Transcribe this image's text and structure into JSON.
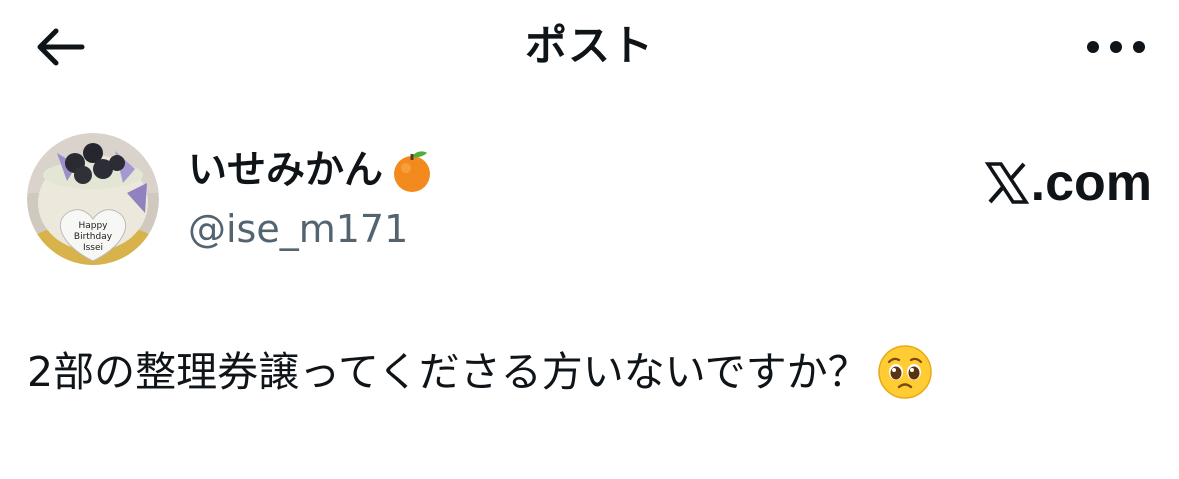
{
  "header": {
    "title": "ポスト",
    "back_icon": "arrow-left-icon",
    "more_icon": "more-horizontal-icon"
  },
  "author": {
    "display_name": "いせみかん",
    "name_emoji": "tangerine-icon",
    "handle": "@ise_m171",
    "avatar_text": [
      "Happy",
      "Birthday",
      "Issei"
    ]
  },
  "brand": {
    "logo_icon": "x-logo-icon",
    "text": ".com"
  },
  "post": {
    "text": "2部の整理券譲ってくださる方いないですか？",
    "emoji": "pleading-face-icon"
  },
  "colors": {
    "text_primary": "#0f1419",
    "text_secondary": "#536471",
    "background": "#ffffff"
  }
}
